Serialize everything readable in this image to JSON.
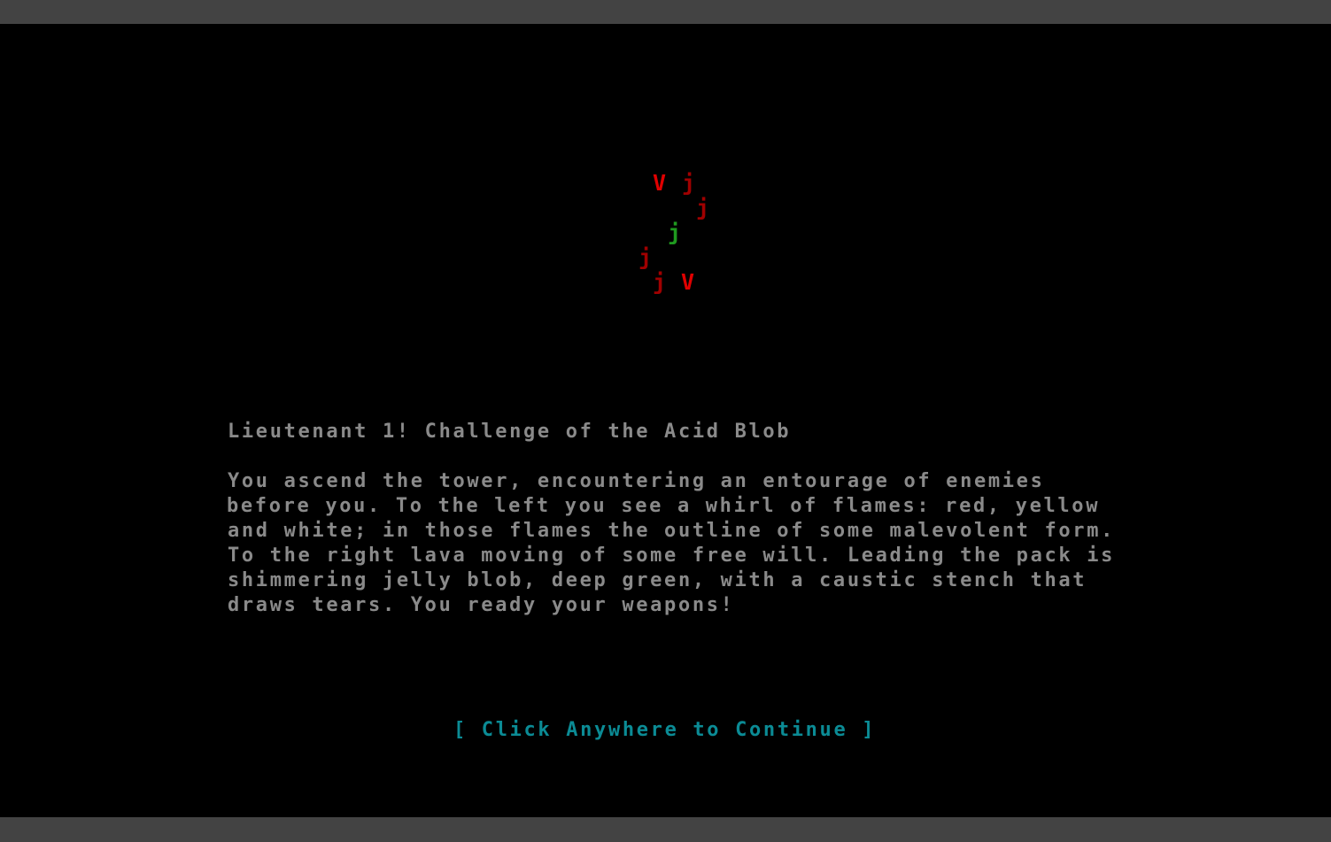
{
  "colors": {
    "window_frame": "#434343",
    "background": "#000000",
    "text": "#8a8a8a",
    "continue": "#0b8b95",
    "red_bright": "#e00000",
    "red_dark": "#a00000",
    "green": "#1f9a1f"
  },
  "enemies": [
    {
      "glyph": "V",
      "name": "whirl-of-flames",
      "color": "#e00000"
    },
    {
      "glyph": "j",
      "name": "lava-blob",
      "color": "#a00000"
    },
    {
      "glyph": "j",
      "name": "lava-blob",
      "color": "#a00000"
    },
    {
      "glyph": "j",
      "name": "acid-blob",
      "color": "#1f9a1f"
    },
    {
      "glyph": "j",
      "name": "lava-blob",
      "color": "#a00000"
    },
    {
      "glyph": "j",
      "name": "lava-blob",
      "color": "#a00000"
    },
    {
      "glyph": "V",
      "name": "whirl-of-flames",
      "color": "#e00000"
    }
  ],
  "title": "Lieutenant 1! Challenge of the Acid Blob",
  "story_lines": [
    "You ascend the tower, encountering an entourage of enemies",
    "before you. To the left you see a whirl of flames: red, yellow",
    "and white; in those flames the outline of some malevolent form.",
    "To the right lava moving of some free will. Leading the pack is",
    "shimmering jelly blob, deep green, with a caustic stench that",
    "draws tears. You ready your weapons!"
  ],
  "continue_prompt": "[ Click Anywhere to Continue ]"
}
